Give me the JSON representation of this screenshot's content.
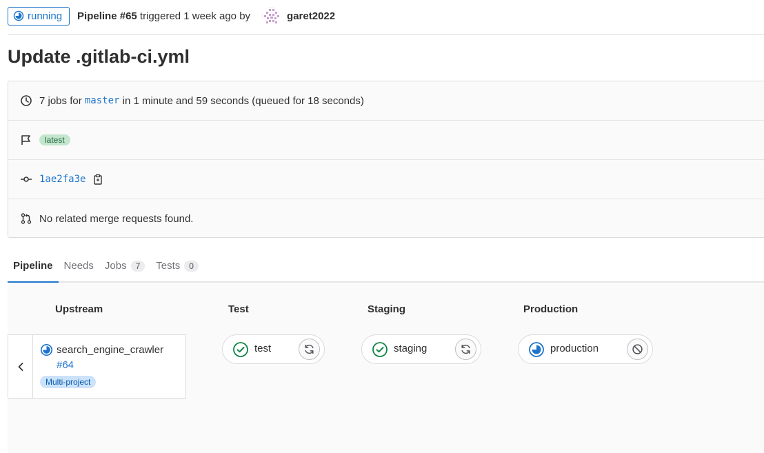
{
  "header": {
    "status_label": "running",
    "pipeline_label": "Pipeline #65",
    "triggered_text": " triggered 1 week ago by",
    "username": "garet2022"
  },
  "title": "Update .gitlab-ci.yml",
  "info": {
    "jobs_prefix": "7 jobs for ",
    "branch": "master",
    "jobs_suffix": " in 1 minute and 59 seconds (queued for 18 seconds)",
    "tag_badge": "latest",
    "commit_sha": "1ae2fa3e",
    "merge_requests": "No related merge requests found."
  },
  "tabs": [
    {
      "label": "Pipeline",
      "count": null
    },
    {
      "label": "Needs",
      "count": null
    },
    {
      "label": "Jobs",
      "count": "7"
    },
    {
      "label": "Tests",
      "count": "0"
    }
  ],
  "graph": {
    "stages": [
      "Upstream",
      "Test",
      "Staging",
      "Production"
    ],
    "upstream": {
      "project": "search_engine_crawler",
      "pipeline": "#64",
      "badge": "Multi-project"
    },
    "jobs": [
      {
        "name": "test",
        "status": "success",
        "action": "retry-icon"
      },
      {
        "name": "staging",
        "status": "success",
        "action": "retry-icon"
      },
      {
        "name": "production",
        "status": "running",
        "action": "cancel-icon"
      }
    ]
  },
  "colors": {
    "accent": "#1f75cb",
    "success": "#108548",
    "text": "#303030"
  }
}
